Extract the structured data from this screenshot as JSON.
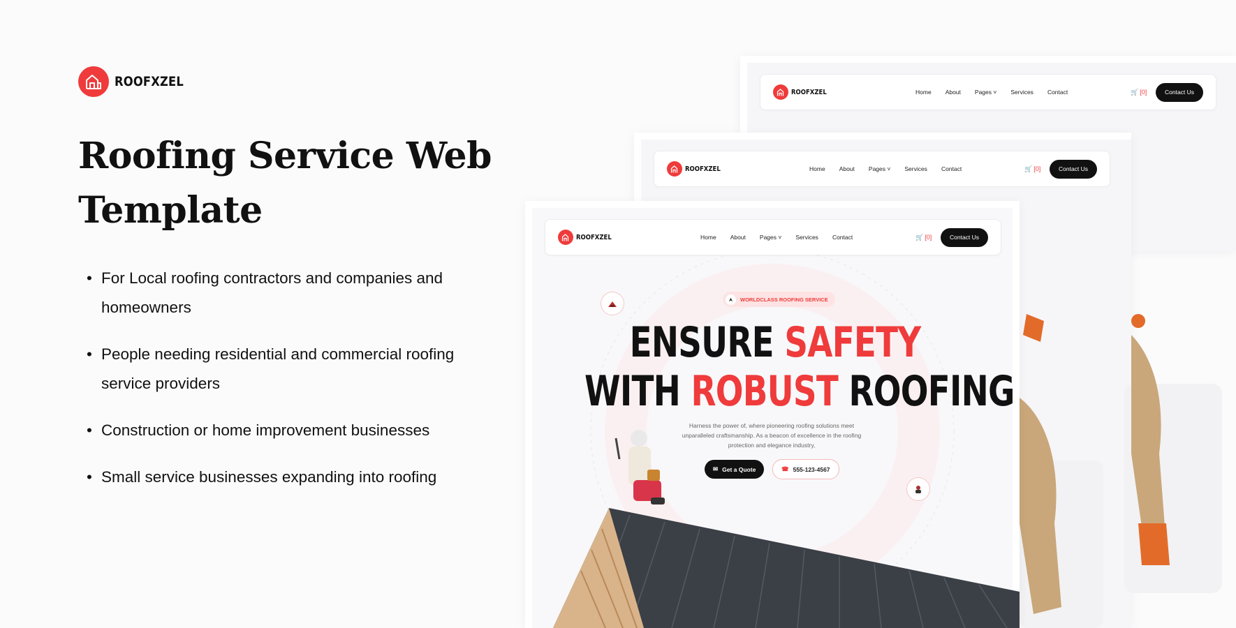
{
  "brand": {
    "name": "ROOFXZEL",
    "accent": "#ef3b3b",
    "icon": "house-logo-icon"
  },
  "title": "Roofing Service Web Template",
  "bullets": [
    "For Local roofing contractors and companies and homeowners",
    "People needing residential and commercial roofing service providers",
    "Construction or home improvement businesses",
    "Small service businesses expanding into roofing"
  ],
  "mockup": {
    "nav": {
      "logo": "ROOFXZEL",
      "items": [
        "Home",
        "About",
        "Pages",
        "Services",
        "Contact"
      ],
      "cart_count": "[0]",
      "cta": "Contact Us"
    },
    "hero": {
      "eyebrow": "WORLDCLASS ROOFING SERVICE",
      "headline_line1_black": "ENSURE ",
      "headline_line1_red": "SAFETY",
      "headline_line2_black_a": "WITH ",
      "headline_line2_red": "ROBUST",
      "headline_line2_black_b": " ROOFING",
      "description": "Harness the power of, where pioneering roofing solutions meet unparalleled craftsmanship. As a beacon of excellence in the roofing protection and elegance industry,",
      "btn_quote": "Get a Quote",
      "btn_phone": "555-123-4567"
    }
  }
}
